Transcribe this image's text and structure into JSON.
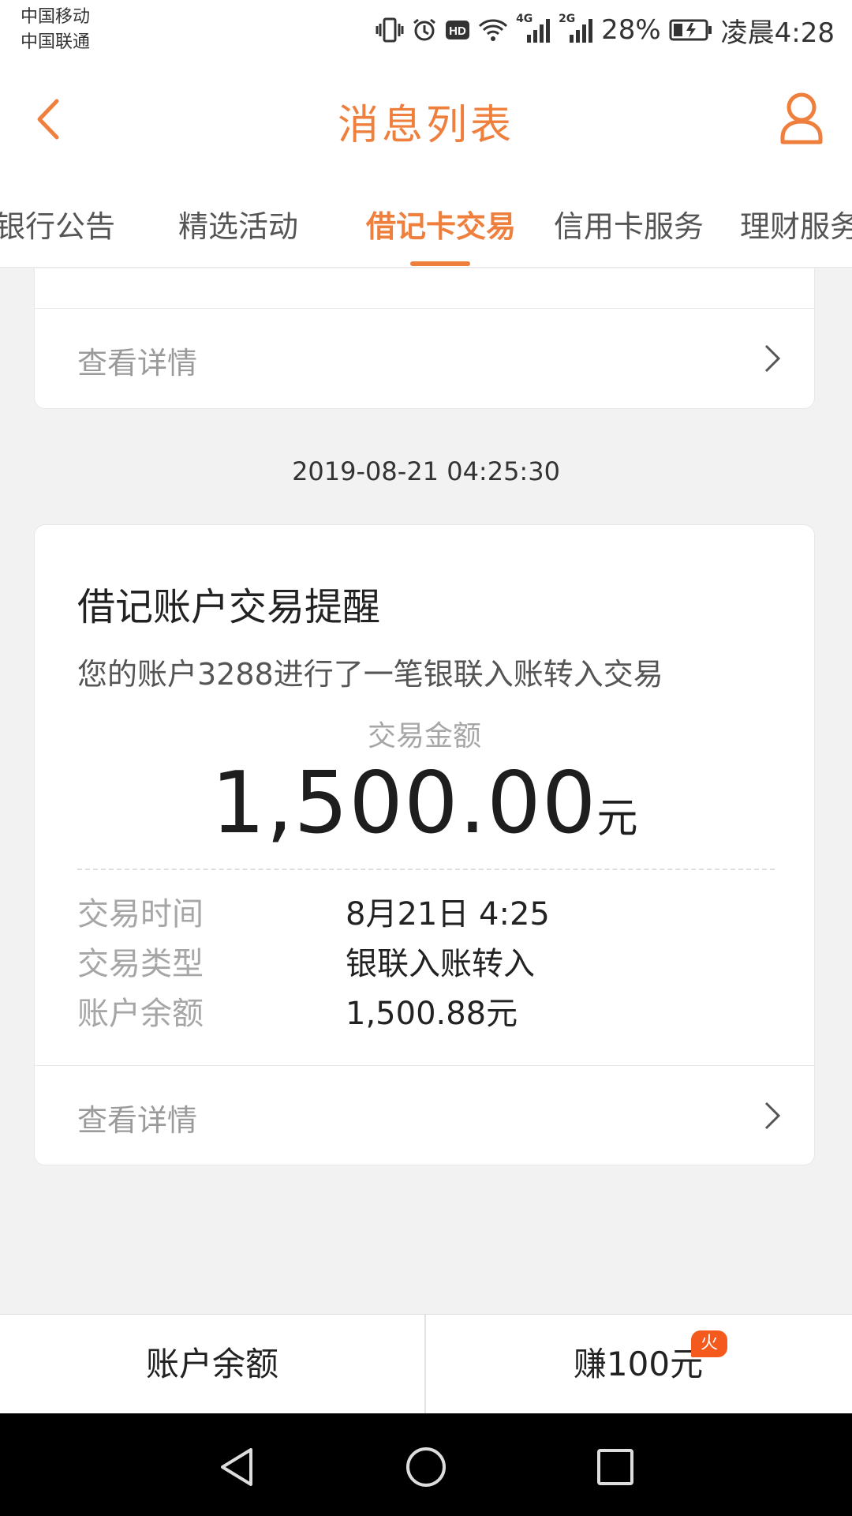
{
  "status_bar": {
    "carrier_1": "中国移动",
    "carrier_2": "中国联通",
    "network_1": "4G",
    "network_2": "2G",
    "battery": "28%",
    "time": "凌晨4:28",
    "icons": [
      "vibrate-icon",
      "alarm-icon",
      "hd-icon",
      "wifi-icon",
      "signal-icon",
      "signal-icon",
      "battery-icon"
    ]
  },
  "header": {
    "title": "消息列表",
    "back_icon": "chevron-left-icon",
    "profile_icon": "user-icon"
  },
  "tabs": [
    {
      "label": "银行公告",
      "active": false
    },
    {
      "label": "精选活动",
      "active": false
    },
    {
      "label": "借记卡交易",
      "active": true
    },
    {
      "label": "信用卡服务",
      "active": false
    },
    {
      "label": "理财服务",
      "active": false
    }
  ],
  "previous_card": {
    "detail_link": "查看详情"
  },
  "message": {
    "timestamp": "2019-08-21 04:25:30",
    "title": "借记账户交易提醒",
    "description": "您的账户3288进行了一笔银联入账转入交易",
    "amount_label": "交易金额",
    "amount_value": "1,500.00",
    "amount_unit": "元",
    "details": [
      {
        "key": "交易时间",
        "value": "8月21日 4:25"
      },
      {
        "key": "交易类型",
        "value": "银联入账转入"
      },
      {
        "key": "账户余额",
        "value": "1,500.88元"
      }
    ],
    "detail_link": "查看详情"
  },
  "bottom_bar": {
    "left_label": "账户余额",
    "right_label": "赚100元",
    "badge": "火"
  },
  "colors": {
    "accent": "#ee7f3c",
    "badge": "#f45a1e",
    "background": "#f2f2f2"
  }
}
